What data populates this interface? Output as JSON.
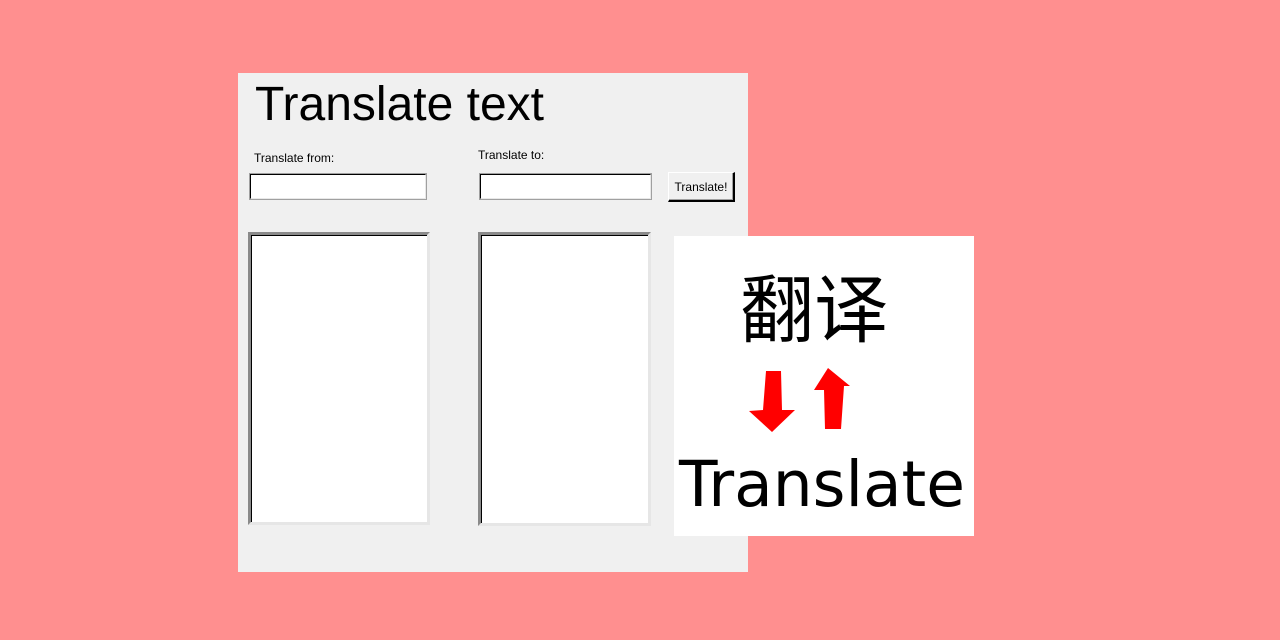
{
  "colors": {
    "page_background": "#ff8f8f",
    "window_background": "#f0f0f0",
    "logo_background": "#ffffff",
    "arrow_color": "#ff0000"
  },
  "window": {
    "title": "Translate text",
    "from_label": "Translate from:",
    "to_label": "Translate to:",
    "from_language_value": "",
    "to_language_value": "",
    "source_text_value": "",
    "target_text_value": "",
    "translate_button_label": "Translate!"
  },
  "logo": {
    "chinese_text": "翻译",
    "english_text": "Translate",
    "arrow_icons": [
      "arrow-down-icon",
      "arrow-up-icon"
    ]
  }
}
